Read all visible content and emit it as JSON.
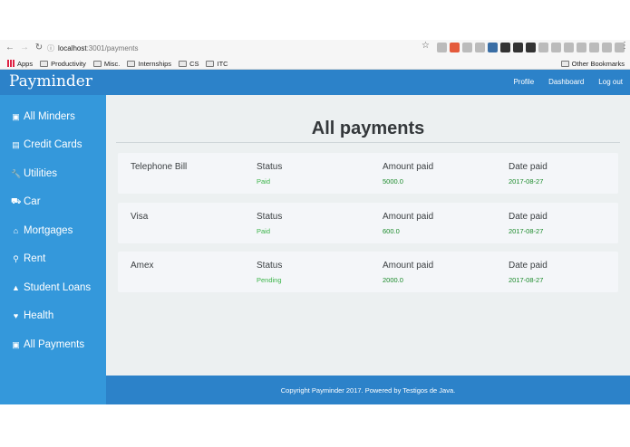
{
  "browser": {
    "url_host": "localhost",
    "url_path": ":3001/payments",
    "bookmarks": [
      "Productivity",
      "Misc.",
      "Internships",
      "CS",
      "ITC"
    ],
    "apps_label": "Apps",
    "other_bookmarks": "Other Bookmarks"
  },
  "header": {
    "brand": "Payminder",
    "nav": [
      "Profile",
      "Dashboard",
      "Log out"
    ]
  },
  "sidebar": {
    "items": [
      {
        "label": "All Minders",
        "icon": "money-icon"
      },
      {
        "label": "Credit Cards",
        "icon": "credit-card-icon"
      },
      {
        "label": "Utilities",
        "icon": "wrench-icon"
      },
      {
        "label": "Car",
        "icon": "car-icon"
      },
      {
        "label": "Mortgages",
        "icon": "home-icon"
      },
      {
        "label": "Rent",
        "icon": "key-icon"
      },
      {
        "label": "Student Loans",
        "icon": "graduation-cap-icon"
      },
      {
        "label": "Health",
        "icon": "heartbeat-icon"
      },
      {
        "label": "All Payments",
        "icon": "money-icon"
      }
    ]
  },
  "main": {
    "title": "All payments",
    "labels": {
      "status": "Status",
      "amount": "Amount paid",
      "date": "Date paid"
    },
    "payments": [
      {
        "name": "Telephone Bill",
        "status": "Paid",
        "amount": "5000.0",
        "date": "2017-08-27"
      },
      {
        "name": "Visa",
        "status": "Paid",
        "amount": "600.0",
        "date": "2017-08-27"
      },
      {
        "name": "Amex",
        "status": "Pending",
        "amount": "2000.0",
        "date": "2017-08-27"
      }
    ]
  },
  "footer": {
    "text": "Copyright Payminder 2017. Powered by Testigos de Java."
  },
  "colors": {
    "header": "#2c82c9",
    "sidebar": "#3498db",
    "main_bg": "#ecf0f1",
    "status_green": "#3cb54a"
  }
}
